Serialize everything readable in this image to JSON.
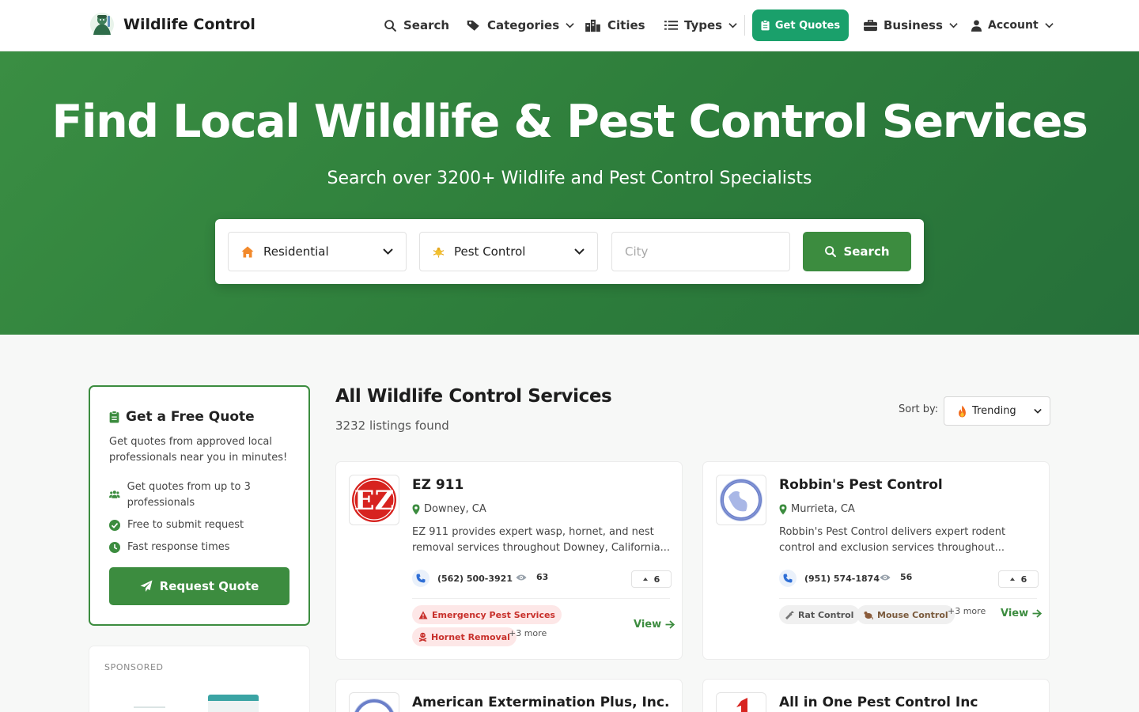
{
  "nav": {
    "brand": "Wildlife Control",
    "search": "Search",
    "categories": "Categories",
    "cities": "Cities",
    "types": "Types",
    "get_quotes": "Get Quotes",
    "business": "Business",
    "account": "Account"
  },
  "hero": {
    "title": "Find Local Wildlife & Pest Control Services",
    "subtitle": "Search over 3200+ Wildlife and Pest Control Specialists",
    "property_type": "Residential",
    "service_type": "Pest Control",
    "city_placeholder": "City",
    "city_value": "",
    "search_label": "Search"
  },
  "sidebar": {
    "quote_title": "Get a Free Quote",
    "quote_desc": "Get quotes from approved local professionals near you in minutes!",
    "features": [
      "Get quotes from up to 3 professionals",
      "Free to submit request",
      "Fast response times"
    ],
    "request_label": "Request Quote",
    "sponsored_label": "SPONSORED"
  },
  "main": {
    "title": "All Wildlife Control Services",
    "count": "3232 listings found",
    "sort_label": "Sort by:",
    "sort_value": "Trending"
  },
  "listings": [
    {
      "name": "EZ 911",
      "location": "Downey, CA",
      "description": "EZ 911 provides expert wasp, hornet, and nest removal services throughout Downey, California...",
      "phone": "(562) 500-3921",
      "views": "63",
      "votes": "6",
      "tags": [
        "Emergency Pest Services",
        "Hornet Removal"
      ],
      "more": "+3 more",
      "view_label": "View"
    },
    {
      "name": "Robbin's Pest Control",
      "location": "Murrieta, CA",
      "description": "Robbin's Pest Control delivers expert rodent control and exclusion services throughout...",
      "phone": "(951) 574-1874",
      "views": "56",
      "votes": "6",
      "tags": [
        "Rat Control",
        "Mouse Control"
      ],
      "more": "+3 more",
      "view_label": "View"
    },
    {
      "name": "American Extermination Plus, Inc."
    },
    {
      "name": "All in One Pest Control Inc"
    }
  ],
  "colors": {
    "brand_green": "#3c8c3f",
    "quote_green": "#1aa06b",
    "emergency_red": "#c8302b"
  }
}
